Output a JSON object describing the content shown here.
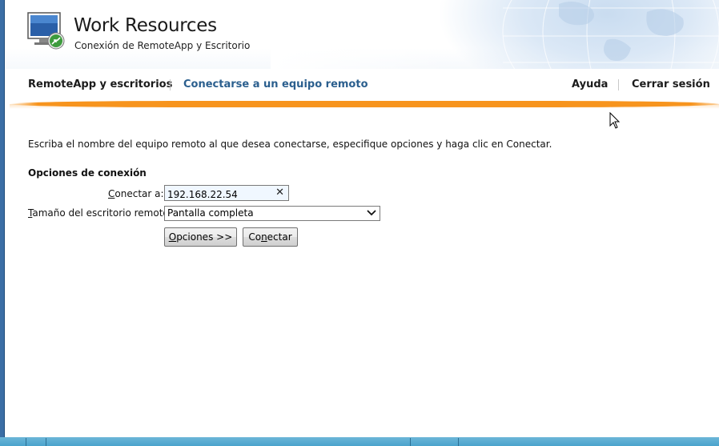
{
  "header": {
    "title": "Work Resources",
    "subtitle": "Conexión de RemoteApp y Escritorio",
    "logo_icon": "remote-desktop-monitor-icon"
  },
  "nav": {
    "remoteapp": "RemoteApp y escritorios",
    "connect_remote": "Conectarse a un equipo remoto",
    "help": "Ayuda",
    "logout": "Cerrar sesión"
  },
  "colors": {
    "accent_blue": "#2b5f8e",
    "orange_bar": "#f7941d",
    "input_bg": "#f0f7ff"
  },
  "main": {
    "instructions": "Escriba el nombre del equipo remoto al que desea conectarse, especifique opciones y haga clic en Conectar.",
    "section_title": "Opciones de conexión",
    "connect_to_label_u": "C",
    "connect_to_label_rest": "onectar a:",
    "connect_to_value": "192.168.22.54",
    "clear_glyph": "✕",
    "desktop_size_label_u": "T",
    "desktop_size_label_rest": "amaño del escritorio remoto:",
    "desktop_size_value": "Pantalla completa",
    "options_button_u": "O",
    "options_button_rest": "pciones >>",
    "connect_button_pre": "Co",
    "connect_button_u": "n",
    "connect_button_rest": "ectar"
  }
}
